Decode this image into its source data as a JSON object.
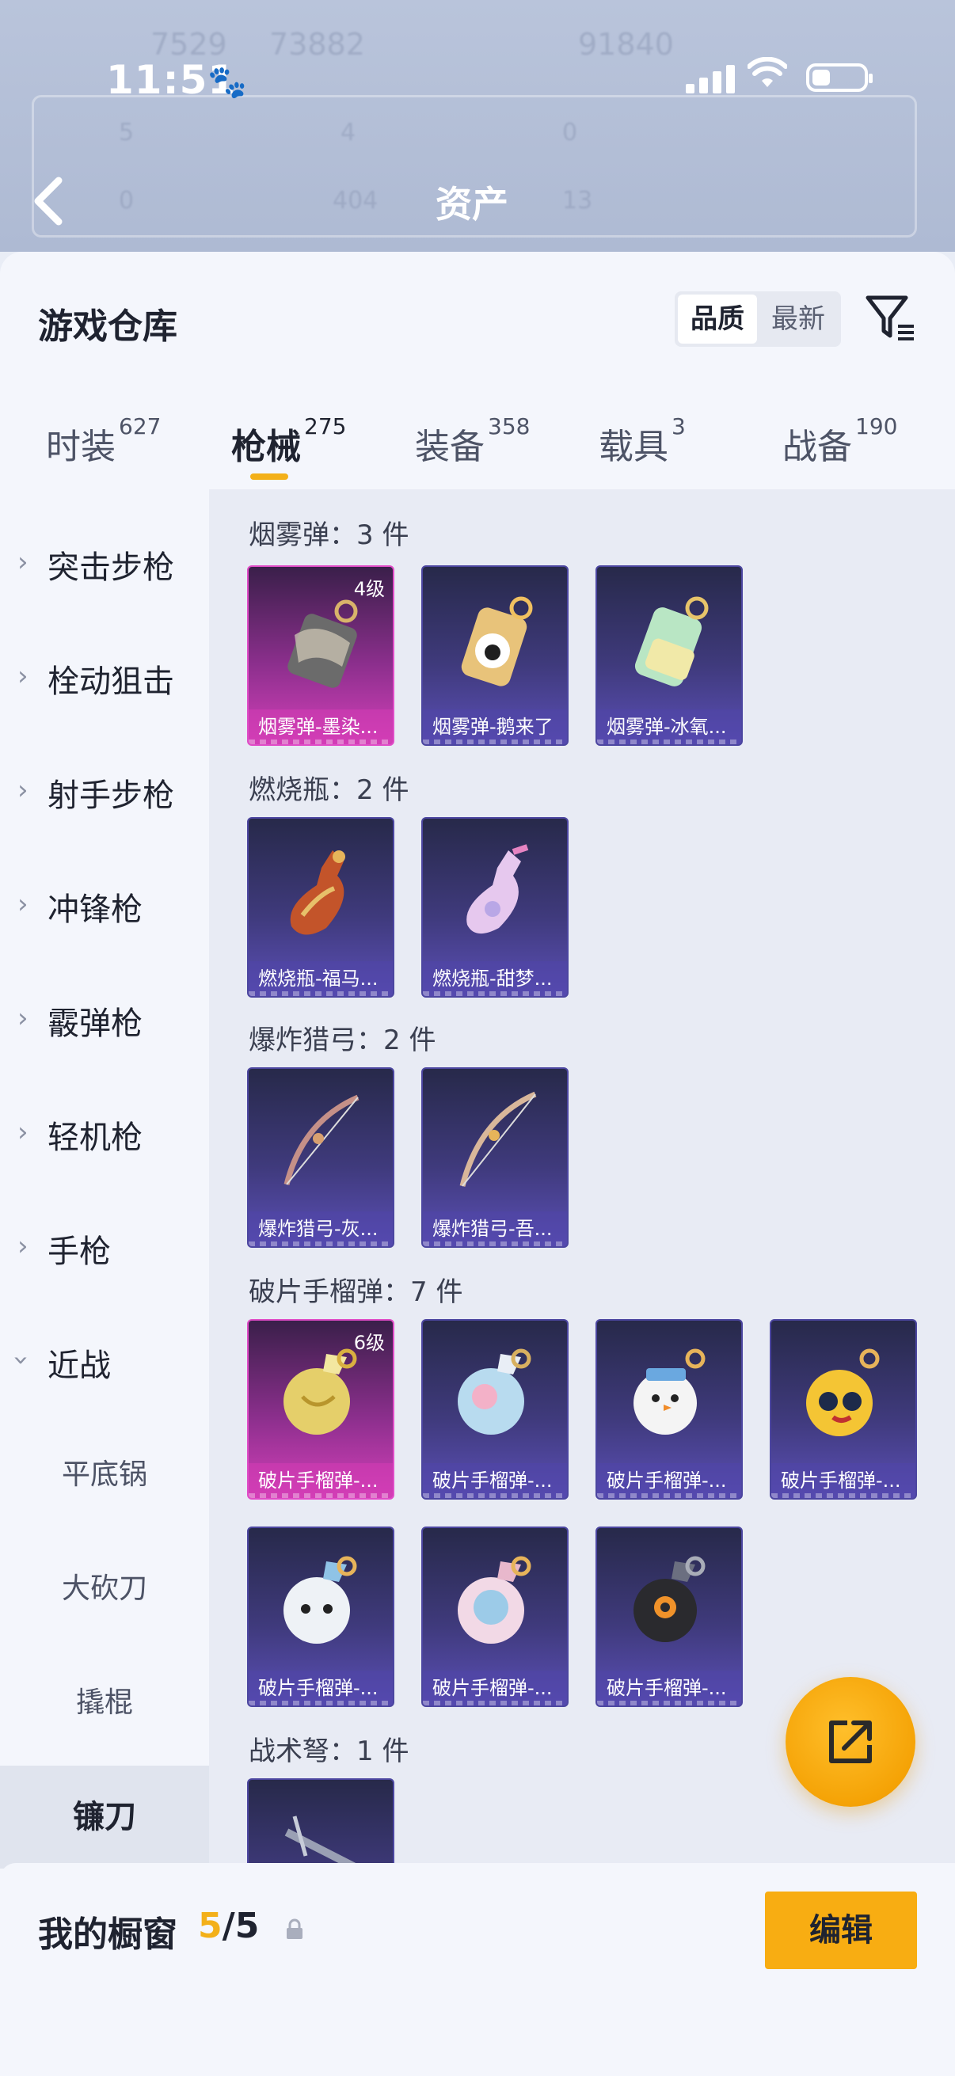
{
  "status_bar": {
    "time": "11:51"
  },
  "header": {
    "title": "资产",
    "ghost_text": [
      "7529",
      "73882",
      "91840",
      "5",
      "4",
      "0",
      "0",
      "404",
      "13"
    ]
  },
  "warehouse": {
    "title": "游戏仓库",
    "sort": {
      "quality": "品质",
      "latest": "最新"
    }
  },
  "tabs": [
    {
      "label": "时装",
      "count": "627"
    },
    {
      "label": "枪械",
      "count": "275"
    },
    {
      "label": "装备",
      "count": "358"
    },
    {
      "label": "载具",
      "count": "3"
    },
    {
      "label": "战备",
      "count": "190"
    }
  ],
  "active_tab": "枪械",
  "sidebar": {
    "categories": [
      "突击步枪",
      "栓动狙击",
      "射手步枪",
      "冲锋枪",
      "霰弹枪",
      "轻机枪",
      "手枪",
      "近战"
    ],
    "subcategories": [
      "平底锅",
      "大砍刀",
      "撬棍",
      "镰刀"
    ],
    "active_sub": "镰刀"
  },
  "groups": [
    {
      "title": "烟雾弹：3 件",
      "items": [
        {
          "name": "烟雾弹-墨染...",
          "level": "4级",
          "rarity": "gold",
          "art": "smoke-dark"
        },
        {
          "name": "烟雾弹-鹅来了",
          "rarity": "purple",
          "art": "smoke-gold"
        },
        {
          "name": "烟雾弹-冰氧...",
          "rarity": "purple",
          "art": "smoke-mint"
        }
      ]
    },
    {
      "title": "燃烧瓶：2 件",
      "items": [
        {
          "name": "燃烧瓶-福马...",
          "rarity": "purple",
          "art": "molotov-red"
        },
        {
          "name": "燃烧瓶-甜梦...",
          "rarity": "purple",
          "art": "molotov-pink"
        }
      ]
    },
    {
      "title": "爆炸猎弓：2 件",
      "items": [
        {
          "name": "爆炸猎弓-灰...",
          "rarity": "purple",
          "art": "bow"
        },
        {
          "name": "爆炸猎弓-吾...",
          "rarity": "purple",
          "art": "bow"
        }
      ]
    },
    {
      "title": "破片手榴弹：7 件",
      "items": [
        {
          "name": "破片手榴弹-...",
          "level": "6级",
          "rarity": "gold",
          "art": "grenade-gold"
        },
        {
          "name": "破片手榴弹-...",
          "rarity": "purple",
          "art": "grenade-blue"
        },
        {
          "name": "破片手榴弹-...",
          "rarity": "purple",
          "art": "grenade-snow"
        },
        {
          "name": "破片手榴弹-...",
          "rarity": "purple",
          "art": "grenade-yellow"
        },
        {
          "name": "破片手榴弹-...",
          "rarity": "purple",
          "art": "grenade-white"
        },
        {
          "name": "破片手榴弹-...",
          "rarity": "purple",
          "art": "grenade-pink"
        },
        {
          "name": "破片手榴弹-...",
          "rarity": "purple",
          "art": "grenade-black"
        }
      ]
    },
    {
      "title": "战术弩：1 件",
      "items": [
        {
          "name": "",
          "rarity": "purple",
          "art": "crossbow"
        }
      ]
    }
  ],
  "showcase": {
    "title": "我的橱窗",
    "current": "5",
    "total": "/5",
    "edit_label": "编辑"
  },
  "colors": {
    "accent": "#f3b019",
    "gold_card": "#d440b9",
    "purple_card": "#5b4fb6",
    "fab": "#f5a306"
  },
  "icons": [
    "back-arrow-icon",
    "filter-icon",
    "chevron-right-icon",
    "chevron-down-icon",
    "share-external-icon",
    "lock-icon"
  ]
}
